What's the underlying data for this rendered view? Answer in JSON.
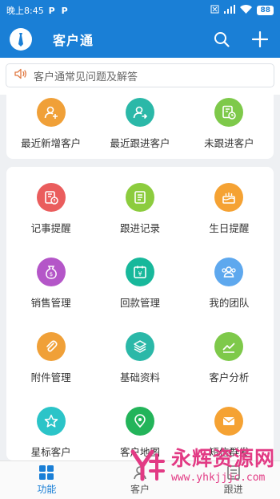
{
  "status_bar": {
    "time": "晚上8:45",
    "app_icons": [
      "P",
      "P"
    ],
    "battery": "88",
    "icons": [
      "sim-x-icon",
      "signal-icon",
      "wifi-icon"
    ]
  },
  "header": {
    "title": "客户通"
  },
  "notice": {
    "text": "客户通常见问题及解答"
  },
  "quick_items": [
    {
      "label": "最近新增客户",
      "icon": "add-user-icon",
      "color": "#f0a038"
    },
    {
      "label": "最近跟进客户",
      "icon": "follow-user-icon",
      "color": "#2bb8a8"
    },
    {
      "label": "未跟进客户",
      "icon": "clock-doc-icon",
      "color": "#7ec94a"
    }
  ],
  "function_items": [
    {
      "label": "记事提醒",
      "icon": "note-alert-icon",
      "color": "#ea5d5d"
    },
    {
      "label": "跟进记录",
      "icon": "record-icon",
      "color": "#8ccc3e"
    },
    {
      "label": "生日提醒",
      "icon": "cake-icon",
      "color": "#f5a233"
    },
    {
      "label": "销售管理",
      "icon": "money-bag-icon",
      "color": "#b456c8"
    },
    {
      "label": "回款管理",
      "icon": "yen-calendar-icon",
      "color": "#18b89b"
    },
    {
      "label": "我的团队",
      "icon": "team-icon",
      "color": "#5ea8ee"
    },
    {
      "label": "附件管理",
      "icon": "paperclip-icon",
      "color": "#f0a038"
    },
    {
      "label": "基础资料",
      "icon": "layers-icon",
      "color": "#2bb8a8"
    },
    {
      "label": "客户分析",
      "icon": "chart-line-icon",
      "color": "#7ec94a"
    },
    {
      "label": "星标客户",
      "icon": "star-icon",
      "color": "#2bc4c8"
    },
    {
      "label": "客户地图",
      "icon": "map-pin-icon",
      "color": "#23b45a"
    },
    {
      "label": "短信群发",
      "icon": "mail-icon",
      "color": "#f5a233"
    }
  ],
  "bottom_nav": [
    {
      "label": "功能",
      "icon": "grid-icon",
      "active": true
    },
    {
      "label": "客户",
      "icon": "customers-icon",
      "active": false
    },
    {
      "label": "跟进",
      "icon": "follow-icon",
      "active": false
    }
  ],
  "watermark": {
    "text": "永辉资源网",
    "url": "www.yhkjjjc.com"
  }
}
